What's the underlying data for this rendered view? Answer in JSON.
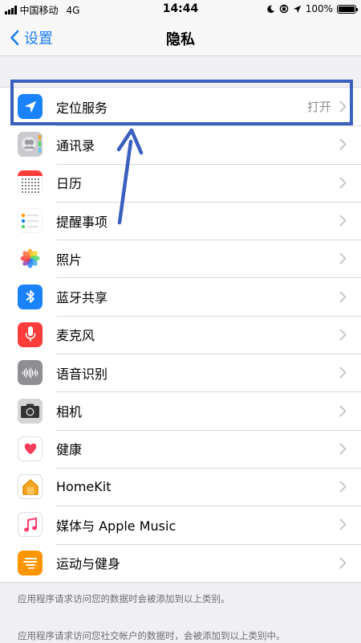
{
  "status_bar": {
    "carrier": "中国移动",
    "network": "4G",
    "time": "14:44",
    "battery": "100%",
    "battery_level": 1.0
  },
  "nav": {
    "back_label": "设置",
    "title": "隐私"
  },
  "rows": [
    {
      "label": "定位服务",
      "value": "打开",
      "icon": "location-arrow-icon",
      "color": "#1a82fb"
    },
    {
      "label": "通讯录",
      "value": "",
      "icon": "contacts-icon",
      "color": "#b8b8bd"
    },
    {
      "label": "日历",
      "value": "",
      "icon": "calendar-icon",
      "color": "#ffffff"
    },
    {
      "label": "提醒事项",
      "value": "",
      "icon": "reminders-icon",
      "color": "#ffffff"
    },
    {
      "label": "照片",
      "value": "",
      "icon": "photos-icon",
      "color": "#ffffff"
    },
    {
      "label": "蓝牙共享",
      "value": "",
      "icon": "bluetooth-icon",
      "color": "#1a82fb"
    },
    {
      "label": "麦克风",
      "value": "",
      "icon": "microphone-icon",
      "color": "#fc3d39"
    },
    {
      "label": "语音识别",
      "value": "",
      "icon": "speech-recognition-icon",
      "color": "#8e8e93"
    },
    {
      "label": "相机",
      "value": "",
      "icon": "camera-icon",
      "color": "#7a7a7f"
    },
    {
      "label": "健康",
      "value": "",
      "icon": "health-icon",
      "color": "#ffffff"
    },
    {
      "label": "HomeKit",
      "value": "",
      "icon": "homekit-icon",
      "color": "#ffffff"
    },
    {
      "label": "媒体与 Apple Music",
      "value": "",
      "icon": "music-icon",
      "color": "#ffffff"
    },
    {
      "label": "运动与健身",
      "value": "",
      "icon": "motion-fitness-icon",
      "color": "#ff9500"
    }
  ],
  "footer": {
    "note1": "应用程序请求访问您的数据时会被添加到以上类别。",
    "note2": "应用程序请求访问您社交帐户的数据时，会被添加到以上类别中。"
  },
  "colors": {
    "accent": "#1f7ef6",
    "annotation": "#3a5fbe"
  }
}
